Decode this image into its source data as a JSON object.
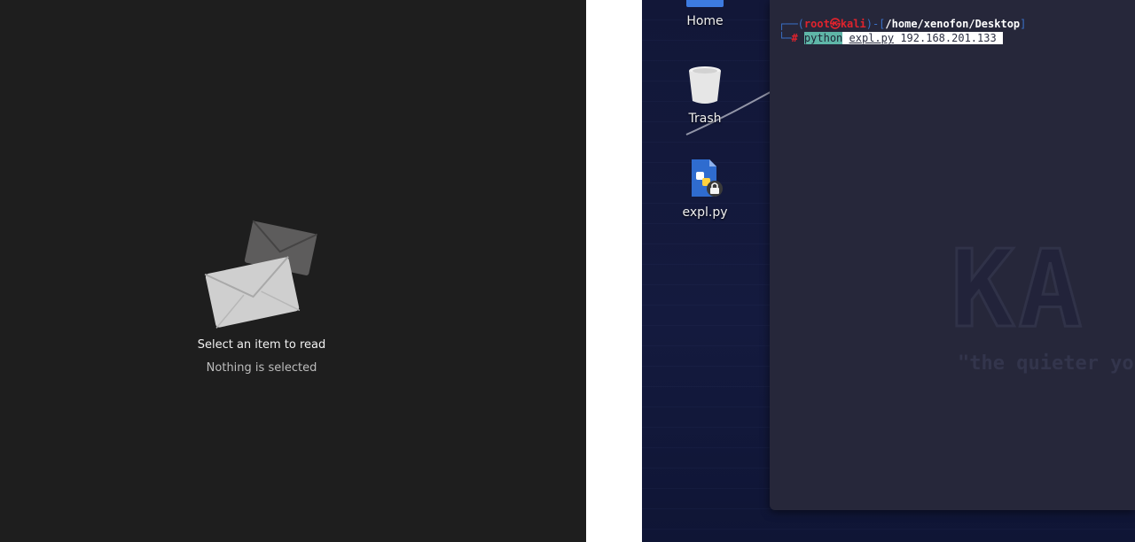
{
  "mail": {
    "empty_title": "Select an item to read",
    "empty_subtitle": "Nothing is selected"
  },
  "desktop": {
    "icons": [
      {
        "label": "Home",
        "icon": "home-folder-icon"
      },
      {
        "label": "Trash",
        "icon": "trash-bin-icon"
      },
      {
        "label": "expl.py",
        "icon": "python-file-locked-icon"
      }
    ],
    "wallpaper_text": "KA",
    "wallpaper_tagline": "\"the quieter yo"
  },
  "terminal": {
    "prompt_open": "┌──(",
    "user": "root",
    "at_symbol": "㉿",
    "host": "kali",
    "mid": ")-[",
    "path": "/home/xenofon/Desktop",
    "close": "]",
    "prompt2_prefix": "└─",
    "hash": "#",
    "cmd": "python",
    "arg_file": "expl.py",
    "arg_ip": "192.168.201.133"
  },
  "colors": {
    "mail_bg": "#1e1e1e",
    "desktop_bg": "#141a3e",
    "terminal_bg": "#26273a",
    "prompt_red": "#e0232d",
    "prompt_blue": "#3a70c8",
    "cmd_highlight": "#5fb6a8"
  }
}
